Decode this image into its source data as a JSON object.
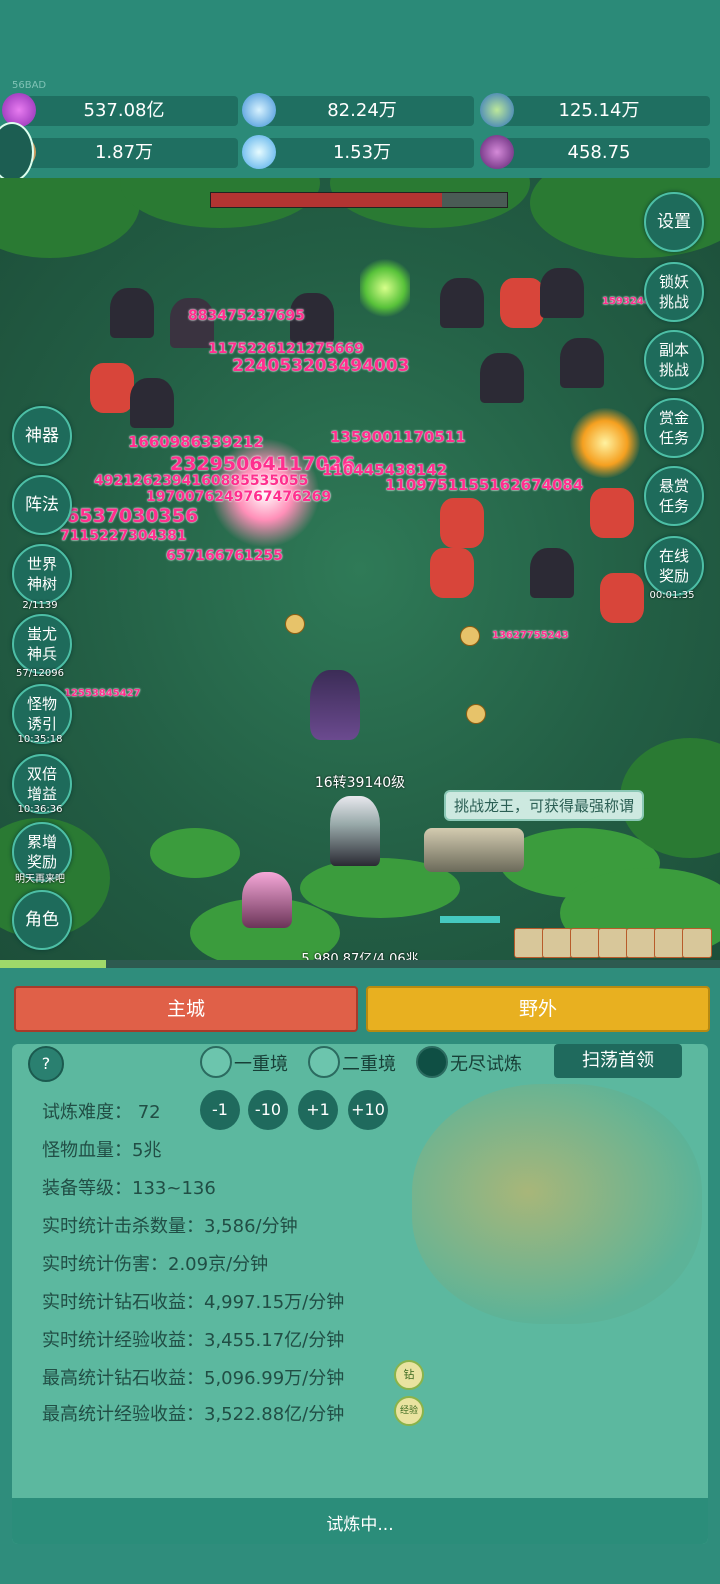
{
  "top": {
    "corner_label": "56BAD",
    "resources": [
      {
        "icon": "purple-gem-icon",
        "value": "537.08亿"
      },
      {
        "icon": "blue-crystal-icon",
        "value": "82.24万"
      },
      {
        "icon": "globe-orb-icon",
        "value": "125.14万"
      },
      {
        "icon": "horn-icon",
        "value": "1.87万"
      },
      {
        "icon": "ice-shard-icon",
        "value": "1.53万"
      },
      {
        "icon": "purple-pouch-icon",
        "value": "458.75"
      }
    ]
  },
  "side_left": [
    {
      "label": "神器",
      "sub": ""
    },
    {
      "label": "阵法",
      "sub": ""
    },
    {
      "label": "世界神树",
      "sub": "2/1139"
    },
    {
      "label": "蚩尤神兵",
      "sub": "57/12096"
    },
    {
      "label": "怪物诱引",
      "sub": "10:35:18"
    },
    {
      "label": "双倍增益",
      "sub": "10:36:36"
    },
    {
      "label": "累增奖励",
      "sub": "明天再来吧"
    },
    {
      "label": "角色",
      "sub": ""
    }
  ],
  "side_right": [
    {
      "label": "设置",
      "sub": ""
    },
    {
      "label": "锁妖挑战",
      "sub": ""
    },
    {
      "label": "副本挑战",
      "sub": ""
    },
    {
      "label": "赏金任务",
      "sub": ""
    },
    {
      "label": "悬赏任务",
      "sub": ""
    },
    {
      "label": "在线奖励",
      "sub": "00:01:35"
    }
  ],
  "battle": {
    "boss_hp_fraction": 0.78,
    "player_level": "16转39140级",
    "hint": "挑战龙王，可获得最强称谓",
    "exp_text": "5,980.87亿/4.06兆",
    "exp_fraction": 0.147,
    "damage_numbers": [
      "883475237695",
      "1175226121275669",
      "224053203494003",
      "1660986339212",
      "23295064117026",
      "110445438142",
      "1109751155162674084",
      "6537030356",
      "4921262394160885535055",
      "1970076249767476269",
      "7115227304381",
      "657166761255",
      "13627755243",
      "12553845427",
      "1359001170511",
      "159324420"
    ]
  },
  "tabs": {
    "main": "主城",
    "wild": "野外"
  },
  "panel": {
    "help": "?",
    "modes": [
      {
        "label": "一重境",
        "selected": false
      },
      {
        "label": "二重境",
        "selected": false
      },
      {
        "label": "无尽试炼",
        "selected": true
      }
    ],
    "sweep_button": "扫荡首领",
    "difficulty_label": "试炼难度：",
    "difficulty_value": "72",
    "adjust": [
      "-1",
      "-10",
      "+1",
      "+10"
    ],
    "stats": [
      "怪物血量：5兆",
      "装备等级：133~136",
      "实时统计击杀数量：3,586/分钟",
      "实时统计伤害：2.09京/分钟",
      "实时统计钻石收益：4,997.15万/分钟",
      "实时统计经验收益：3,455.17亿/分钟",
      "最高统计钻石收益：5,096.99万/分钟",
      "最高统计经验收益：3,522.88亿/分钟"
    ],
    "badge_diamond": "钻",
    "badge_exp": "经验",
    "status": "试炼中..."
  }
}
